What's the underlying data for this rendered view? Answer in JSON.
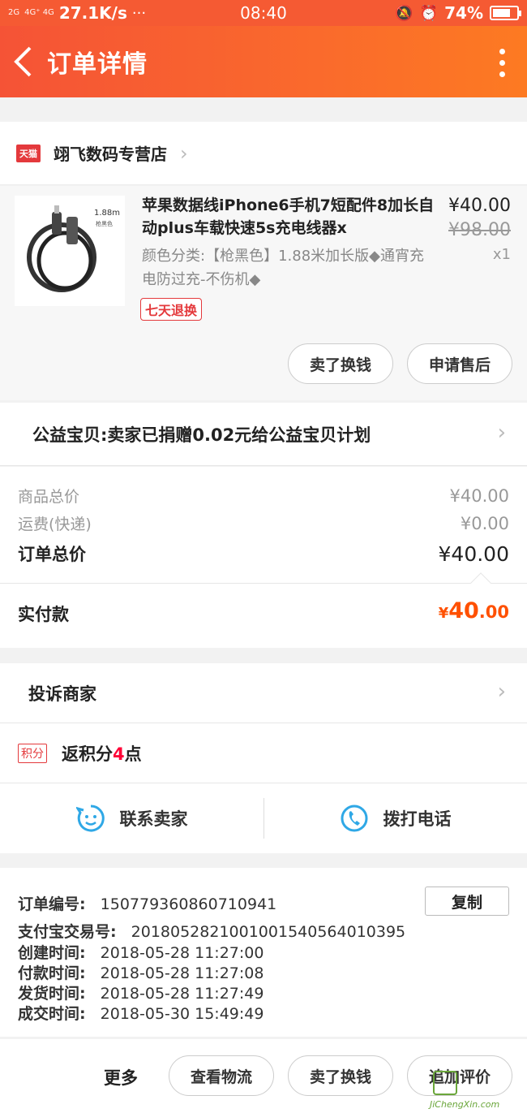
{
  "status_bar": {
    "signal_1": "2G",
    "signal_2": "4G⁺ 4G",
    "net_speed": "27.1K/s",
    "dots": "···",
    "time": "08:40",
    "battery_pct": "74%",
    "battery_level": 0.74
  },
  "navbar": {
    "back_glyph": "‹",
    "title": "订单详情"
  },
  "shop": {
    "badge": "天猫",
    "name": "翊飞数码专营店"
  },
  "product": {
    "title": "苹果数据线iPhone6手机7短配件8加长自动plus车载快速5s充电线器x",
    "sku": "颜色分类:【枪黑色】1.88米加长版◆通宵充电防过充-不伤机◆",
    "price": "¥40.00",
    "original_price": "¥98.00",
    "quantity": "x1",
    "image_label": "1.88m",
    "image_sublabel": "枪黑色",
    "return_tag": "七天退换",
    "sell_button": "卖了换钱",
    "aftersale_button": "申请售后"
  },
  "charity": {
    "text": "公益宝贝:卖家已捐赠0.02元给公益宝贝计划"
  },
  "costs": {
    "goods_total_label": "商品总价",
    "goods_total_value": "¥40.00",
    "shipping_label": "运费(快递)",
    "shipping_value": "¥0.00",
    "order_total_label": "订单总价",
    "order_total_value": "¥40.00"
  },
  "paid": {
    "label": "实付款",
    "currency": "¥",
    "integer": "40",
    "decimal": ".00"
  },
  "complain": {
    "label": "投诉商家"
  },
  "points": {
    "badge": "积分",
    "prefix": "返积分",
    "number": "4",
    "suffix": "点"
  },
  "contact": {
    "seller_label": "联系卖家",
    "phone_label": "拨打电话"
  },
  "order_info": {
    "order_no_label": "订单编号:",
    "order_no": "150779360860710941",
    "alipay_label": "支付宝交易号:",
    "alipay_no": "2018052821001001540564010395",
    "created_label": "创建时间:",
    "created": "2018-05-28 11:27:00",
    "paid_label": "付款时间:",
    "paid": "2018-05-28 11:27:08",
    "shipped_label": "发货时间:",
    "shipped": "2018-05-28 11:27:49",
    "closed_label": "成交时间:",
    "closed": "2018-05-30 15:49:49",
    "copy_button": "复制"
  },
  "bottom_bar": {
    "more_label": "更多",
    "logistics_button": "查看物流",
    "sell_button": "卖了换钱",
    "review_button": "追加评价"
  },
  "watermark": {
    "text": "JiChengXin.com"
  },
  "colors": {
    "accent": "#f55a33",
    "price_orange": "#ff5000",
    "tmall_red": "#e4393c",
    "contact_blue": "#2fa8e6"
  }
}
